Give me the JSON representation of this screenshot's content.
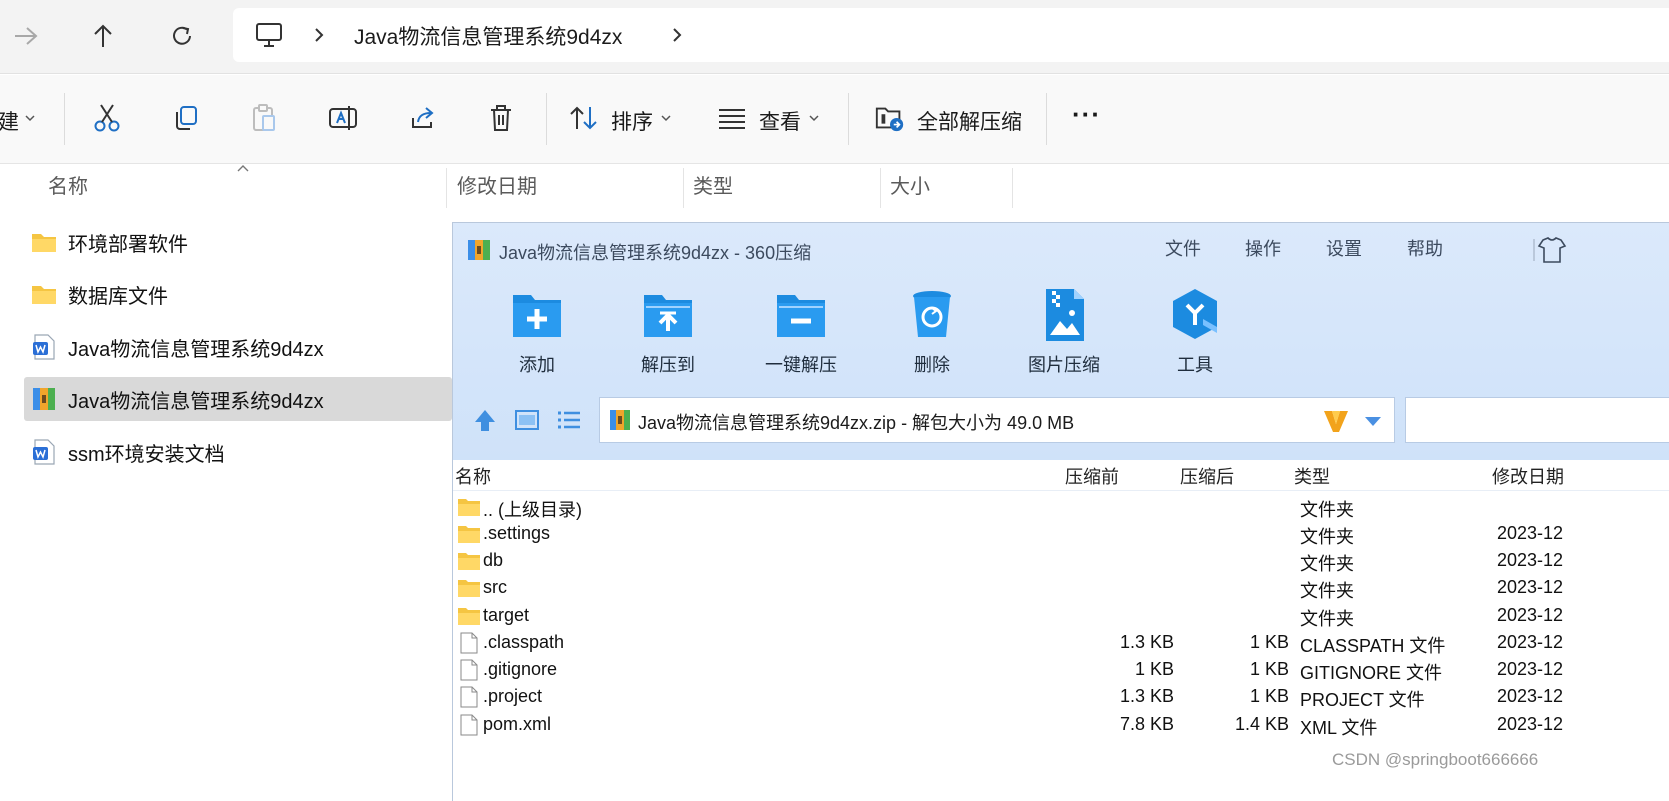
{
  "explorer": {
    "nav": {
      "forward_icon": "arrow-right-icon",
      "up_icon": "arrow-up-icon",
      "refresh_icon": "refresh-icon"
    },
    "address": {
      "computer_icon": "computer-icon",
      "crumb": "Java物流信息管理系统9d4zx"
    },
    "commands": {
      "new_label": "建",
      "sort_label": "排序",
      "view_label": "查看",
      "extract_all_label": "全部解压缩",
      "more_label": "···"
    },
    "columns": {
      "name": "名称",
      "modified": "修改日期",
      "type": "类型",
      "size": "大小"
    },
    "items": [
      {
        "label": "环境部署软件",
        "icon": "folder-icon"
      },
      {
        "label": "数据库文件",
        "icon": "folder-icon"
      },
      {
        "label": "Java物流信息管理系统9d4zx",
        "icon": "word-doc-icon"
      },
      {
        "label": "Java物流信息管理系统9d4zx",
        "icon": "zip-archive-icon"
      },
      {
        "label": "ssm环境安装文档",
        "icon": "word-doc-icon"
      }
    ]
  },
  "zip": {
    "title": "Java物流信息管理系统9d4zx - 360压缩",
    "menu": [
      "文件",
      "操作",
      "设置",
      "帮助"
    ],
    "tools": [
      {
        "label": "添加",
        "icon": "add-folder-icon"
      },
      {
        "label": "解压到",
        "icon": "extract-to-icon"
      },
      {
        "label": "一键解压",
        "icon": "one-click-extract-icon"
      },
      {
        "label": "删除",
        "icon": "delete-icon"
      },
      {
        "label": "图片压缩",
        "icon": "image-compress-icon"
      },
      {
        "label": "工具",
        "icon": "tools-icon"
      }
    ],
    "path": "Java物流信息管理系统9d4zx.zip - 解包大小为 49.0 MB",
    "columns": {
      "name": "名称",
      "before": "压缩前",
      "after": "压缩后",
      "type": "类型",
      "modified": "修改日期"
    },
    "rows": [
      {
        "name": ".. (上级目录)",
        "before": "",
        "after": "",
        "type": "文件夹",
        "date": "",
        "icon": "folder-icon"
      },
      {
        "name": ".settings",
        "before": "",
        "after": "",
        "type": "文件夹",
        "date": "2023-12",
        "icon": "folder-icon"
      },
      {
        "name": "db",
        "before": "",
        "after": "",
        "type": "文件夹",
        "date": "2023-12",
        "icon": "folder-icon"
      },
      {
        "name": "src",
        "before": "",
        "after": "",
        "type": "文件夹",
        "date": "2023-12",
        "icon": "folder-icon"
      },
      {
        "name": "target",
        "before": "",
        "after": "",
        "type": "文件夹",
        "date": "2023-12",
        "icon": "folder-icon"
      },
      {
        "name": ".classpath",
        "before": "1.3 KB",
        "after": "1 KB",
        "type": "CLASSPATH 文件",
        "date": "2023-12",
        "icon": "file-icon"
      },
      {
        "name": ".gitignore",
        "before": "1 KB",
        "after": "1 KB",
        "type": "GITIGNORE 文件",
        "date": "2023-12",
        "icon": "file-icon"
      },
      {
        "name": ".project",
        "before": "1.3 KB",
        "after": "1 KB",
        "type": "PROJECT 文件",
        "date": "2023-12",
        "icon": "file-icon"
      },
      {
        "name": "pom.xml",
        "before": "7.8 KB",
        "after": "1.4 KB",
        "type": "XML 文件",
        "date": "2023-12",
        "icon": "file-icon"
      }
    ]
  },
  "watermark": "CSDN @springboot666666",
  "colors": {
    "zip_header": "#d3e4fa",
    "accent_blue": "#1c8be0",
    "folder_yellow": "#f5c542",
    "selected_row": "#d9d9d9"
  }
}
